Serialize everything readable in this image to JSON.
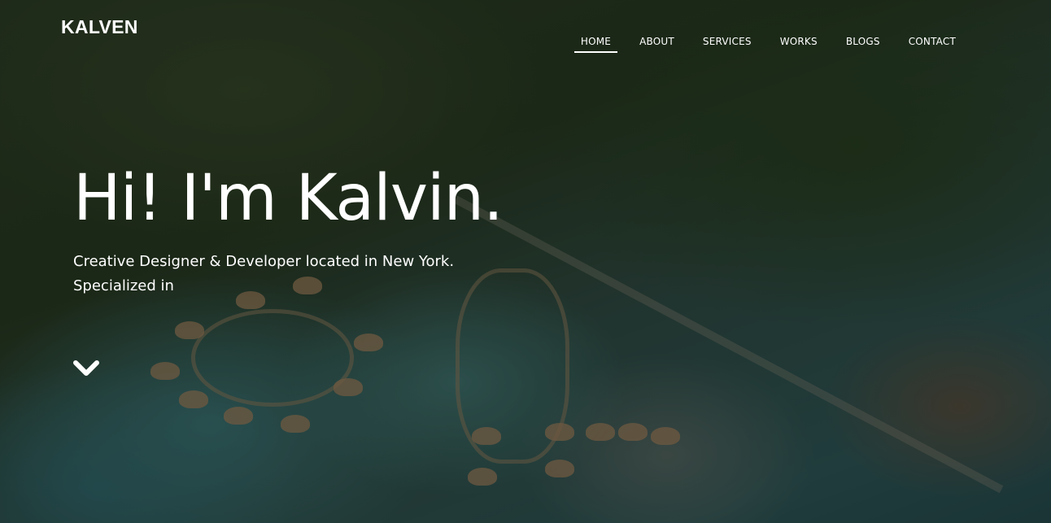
{
  "brand": {
    "name": "KALVEN"
  },
  "nav": {
    "items": [
      {
        "label": "HOME",
        "active": true
      },
      {
        "label": "ABOUT",
        "active": false
      },
      {
        "label": "SERVICES",
        "active": false
      },
      {
        "label": "WORKS",
        "active": false
      },
      {
        "label": "BLOGS",
        "active": false
      },
      {
        "label": "CONTACT",
        "active": false
      }
    ]
  },
  "hero": {
    "title": "Hi! I'm Kalvin.",
    "subtitle_line1": "Creative Designer & Developer located in New York.",
    "subtitle_line2": "Specialized in",
    "scroll_icon": "chevron-down-icon"
  },
  "colors": {
    "text": "#ffffff",
    "overlay": "#0a0e0a"
  }
}
